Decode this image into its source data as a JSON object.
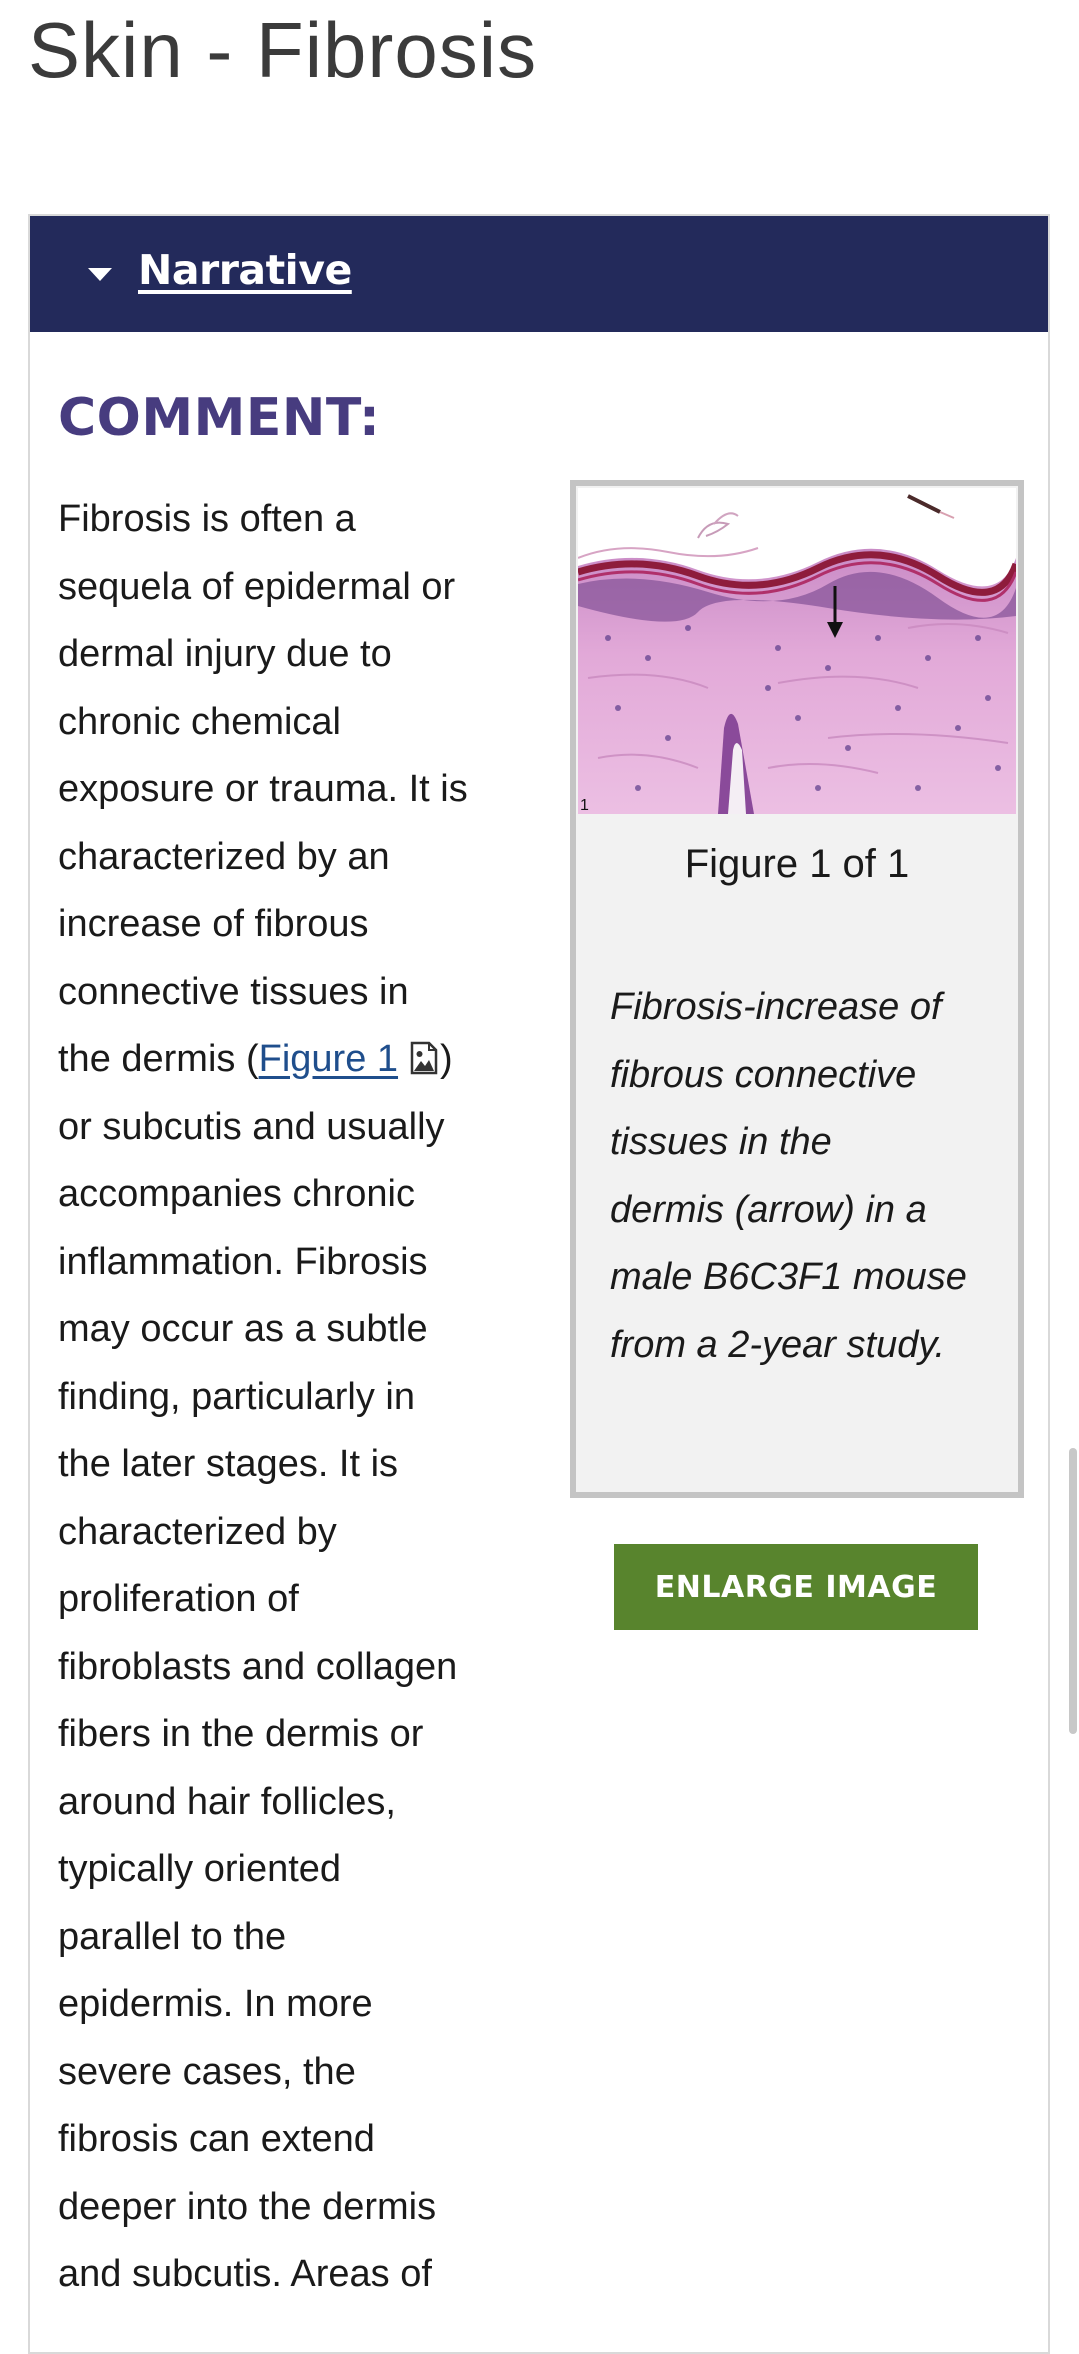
{
  "page": {
    "title": "Skin - Fibrosis"
  },
  "narrative": {
    "toggle_icon": "caret-down-icon",
    "label": "Narrative"
  },
  "comment": {
    "heading": "COMMENT:",
    "lines": [
      "Fibrosis is often a",
      "sequela of epidermal or",
      "dermal injury due to",
      "chronic chemical",
      "exposure or trauma. It is",
      "characterized by an",
      "increase of fibrous",
      "connective tissues in",
      "or subcutis and usually",
      "accompanies chronic",
      "inflammation. Fibrosis",
      "may occur as a subtle",
      "finding, particularly in",
      "the later stages. It is",
      "characterized by",
      "proliferation of",
      "fibroblasts and collagen",
      "fibers in the dermis or",
      "around hair follicles,",
      "typically oriented",
      "parallel to the",
      "epidermis. In more",
      "severe cases, the",
      "fibrosis can extend",
      "deeper into the dermis",
      "and subcutis. Areas of"
    ],
    "figure_line_prefix": "the dermis (",
    "figure_link": "Figure 1",
    "figure_link_icon": "image-icon",
    "figure_line_suffix": ")"
  },
  "figure": {
    "image_number": "1",
    "counter": "Figure 1 of 1",
    "caption_lines": [
      "Fibrosis-increase of",
      "fibrous connective",
      "tissues in the",
      "dermis (arrow) in a",
      "male B6C3F1 mouse",
      "from a 2-year study."
    ],
    "enlarge_label": "ENLARGE IMAGE"
  },
  "colors": {
    "header_bg": "#232a5b",
    "heading": "#473c7f",
    "link": "#1f4e8c",
    "button": "#58842d"
  }
}
